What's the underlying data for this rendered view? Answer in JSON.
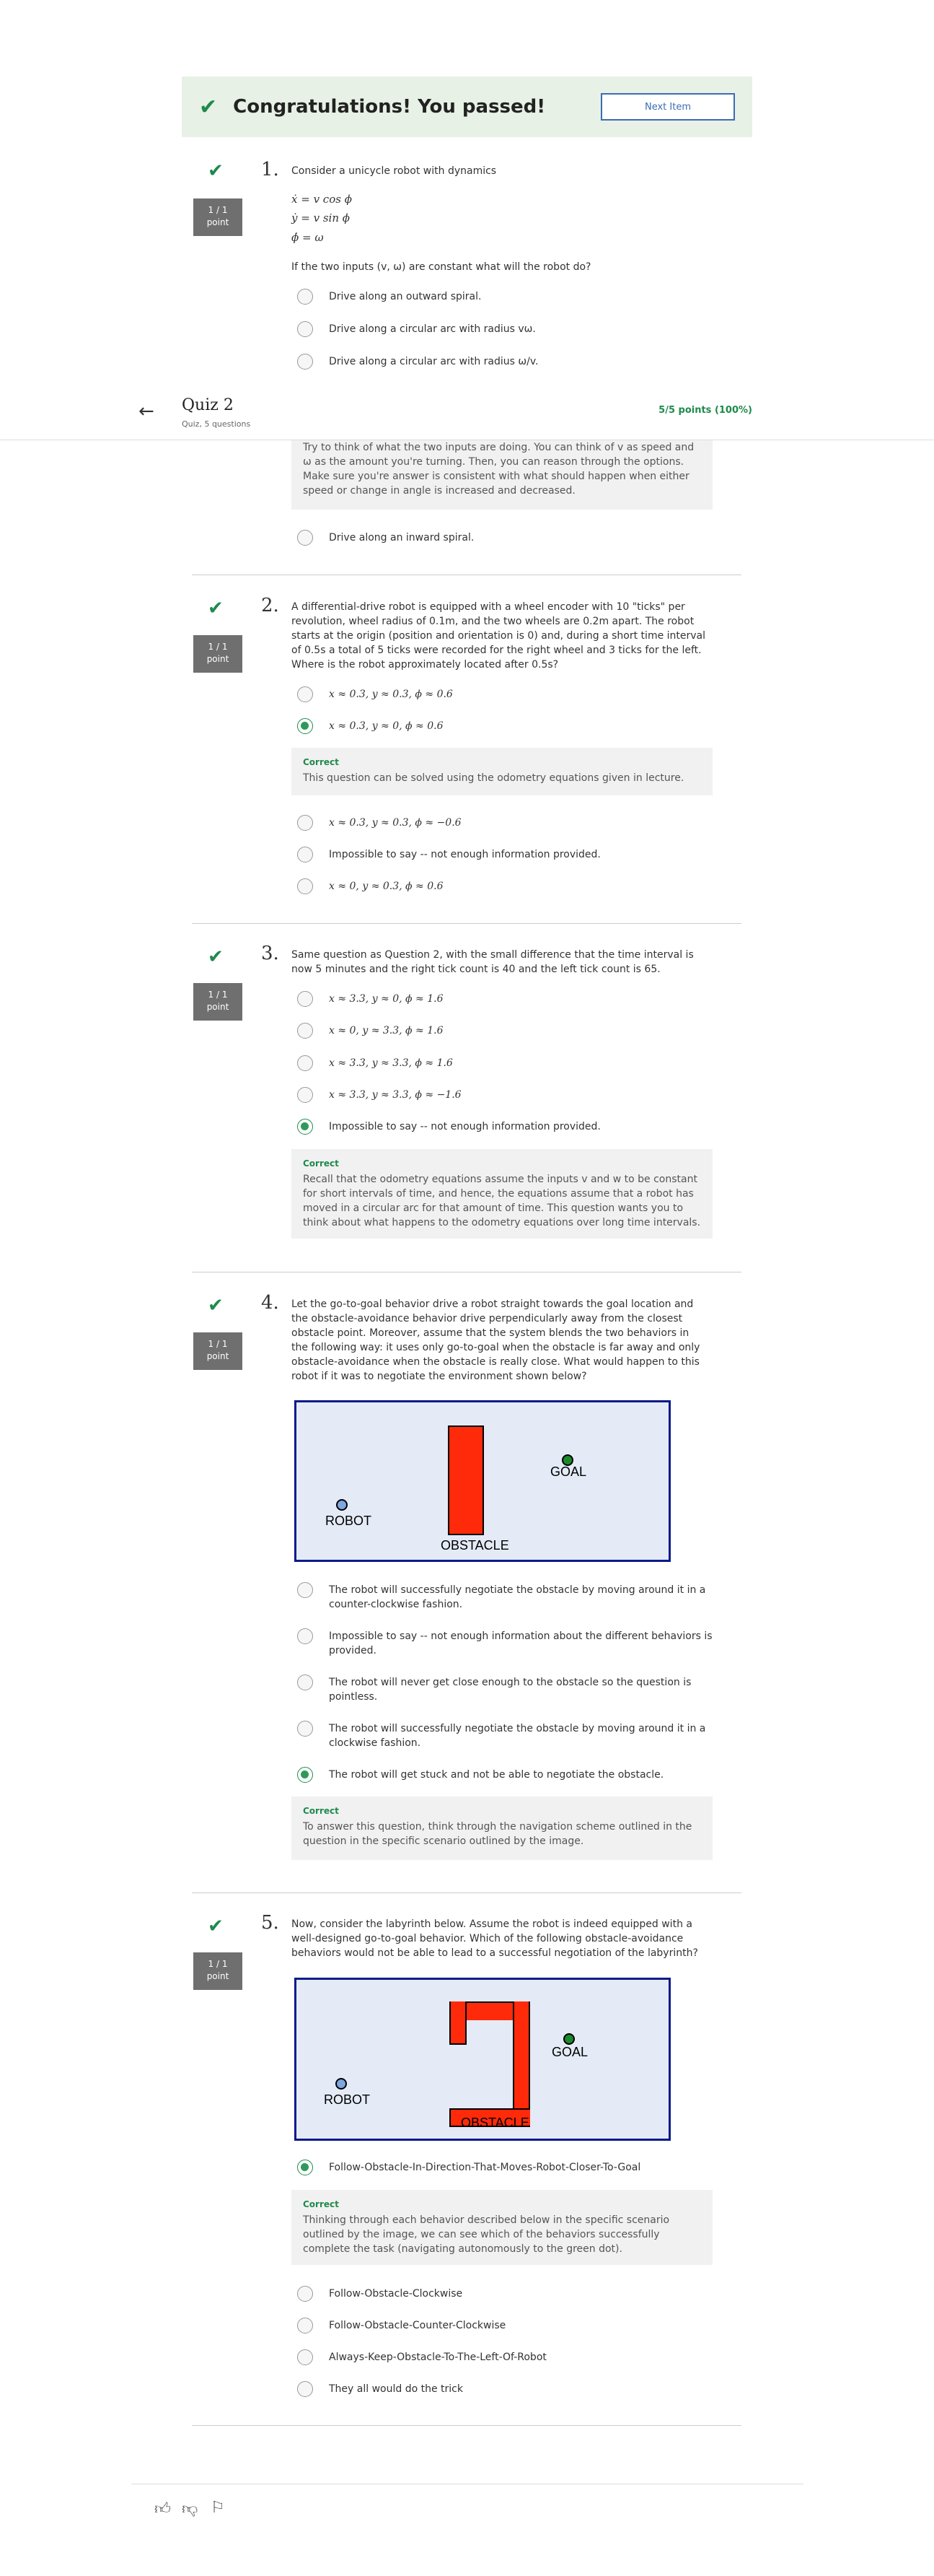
{
  "banner": {
    "message": "Congratulations! You passed!",
    "next_label": "Next Item"
  },
  "header": {
    "title": "Quiz 2",
    "subtitle": "Quiz, 5 questions",
    "score": "5/5 points (100%)"
  },
  "point_label": {
    "score": "1 / 1",
    "unit": "point"
  },
  "feedback_correct": "Correct",
  "q1": {
    "num": "1.",
    "text": "Consider a unicycle robot with dynamics",
    "eq1": "ẋ = v cos ϕ",
    "eq2": "ẏ = v sin ϕ",
    "eq3": "ϕ̇ = ω",
    "prompt": "If the two inputs (v, ω) are constant what will the robot do?",
    "options": [
      "Drive along an outward spiral.",
      "Drive along a circular arc with radius vω.",
      "Drive along a circular arc with radius ω/v.",
      "Drive along an inward spiral."
    ],
    "hint": "Try to think of what the two inputs are doing. You can think of v as speed and ω as the amount you're turning. Then, you can reason through the options. Make sure you're answer is consistent with what should happen when either speed or change in angle is increased and decreased."
  },
  "q2": {
    "num": "2.",
    "text": "A differential-drive robot is equipped with a wheel encoder with 10 \"ticks\" per revolution, wheel radius of 0.1m, and the two wheels are 0.2m apart. The robot starts at the origin (position and orientation is 0) and, during a short time interval of 0.5s a total of 5 ticks were recorded for the right wheel and 3 ticks for the left. Where is the robot approximately located after 0.5s?",
    "options": [
      "x ≈ 0.3,  y ≈ 0.3,  ϕ ≈ 0.6",
      "x ≈ 0.3,  y ≈ 0,  ϕ ≈ 0.6",
      "x ≈ 0.3,  y ≈ 0.3,  ϕ ≈ −0.6",
      "Impossible to say -- not enough information provided.",
      "x ≈ 0,  y ≈ 0.3,  ϕ ≈ 0.6"
    ],
    "feedback": "This question can be solved using the odometry equations given in lecture."
  },
  "q3": {
    "num": "3.",
    "text": "Same question as Question 2, with the small difference that the time interval is now 5 minutes and the right tick count is 40 and the left tick count is 65.",
    "options": [
      "x ≈ 3.3,  y ≈ 0,  ϕ ≈ 1.6",
      "x ≈ 0,  y ≈ 3.3,  ϕ ≈ 1.6",
      "x ≈ 3.3,  y ≈ 3.3,  ϕ ≈ 1.6",
      "x ≈ 3.3,  y ≈ 3.3,  ϕ ≈ −1.6",
      "Impossible to say -- not enough information provided."
    ],
    "feedback": "Recall that the odometry equations assume the inputs v and w to be constant for short intervals of time, and hence, the equations assume that a robot has moved in a circular arc for that amount of time. This question wants you to think about what happens to the odometry equations over long time intervals."
  },
  "q4": {
    "num": "4.",
    "text": "Let the go-to-goal behavior drive a robot straight towards the goal location and the obstacle-avoidance behavior drive perpendicularly away from the closest obstacle point. Moreover, assume that the system blends the two behaviors in the following way: it uses only go-to-goal when the obstacle is far away and only obstacle-avoidance when the obstacle is really close. What would happen to this robot if it was to negotiate the environment shown below?",
    "diagram": {
      "robot": "ROBOT",
      "goal": "GOAL",
      "obstacle": "OBSTACLE"
    },
    "options": [
      "The robot will successfully negotiate the obstacle by moving around it in a counter-clockwise fashion.",
      "Impossible to say -- not enough information about the different behaviors is provided.",
      "The robot will never get close enough to the obstacle so the question is pointless.",
      "The robot will successfully negotiate the obstacle by moving around it in a clockwise fashion.",
      "The robot will get stuck and not be able to negotiate the obstacle."
    ],
    "feedback": "To answer this question, think through the navigation scheme outlined in the question in the specific scenario outlined by the image."
  },
  "q5": {
    "num": "5.",
    "text": "Now, consider the labyrinth below. Assume the robot is indeed equipped with a well-designed go-to-goal behavior. Which of the following obstacle-avoidance behaviors would not be able to lead to a successful negotiation of the labyrinth?",
    "diagram": {
      "robot": "ROBOT",
      "goal": "GOAL",
      "obstacle": "OBSTACLE"
    },
    "options": [
      "Follow-Obstacle-In-Direction-That-Moves-Robot-Closer-To-Goal",
      "Follow-Obstacle-Clockwise",
      "Follow-Obstacle-Counter-Clockwise",
      "Always-Keep-Obstacle-To-The-Left-Of-Robot",
      "They all would do the trick"
    ],
    "feedback": "Thinking through each behavior described below in the specific scenario outlined by the image, we can see which of the behaviors successfully complete the task (navigating autonomously to the green dot)."
  },
  "footer": {
    "like_icon": "thumbs-up-icon",
    "dislike_icon": "thumbs-down-icon",
    "flag_icon": "flag-icon"
  }
}
